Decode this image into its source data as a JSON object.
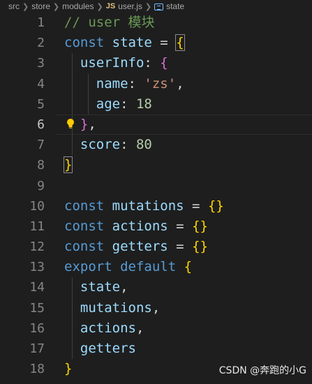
{
  "breadcrumb": {
    "items": [
      "src",
      "store",
      "modules"
    ],
    "file_badge": "JS",
    "file": "user.js",
    "symbol": "state",
    "symbol_icon": "symbol-variable-icon"
  },
  "editor": {
    "active_line": 6,
    "lines": [
      {
        "num": "1",
        "tokens": [
          {
            "c": "cmt",
            "t": "// user 模块"
          }
        ]
      },
      {
        "num": "2",
        "tokens": [
          {
            "c": "kw",
            "t": "const"
          },
          {
            "c": "op",
            "t": " "
          },
          {
            "c": "var",
            "t": "state"
          },
          {
            "c": "op",
            "t": " = "
          },
          {
            "c": "b1 b-hl",
            "t": "{"
          }
        ]
      },
      {
        "num": "3",
        "tokens": [
          {
            "c": "op",
            "t": "  "
          },
          {
            "c": "prop",
            "t": "userInfo"
          },
          {
            "c": "op",
            "t": ": "
          },
          {
            "c": "b2",
            "t": "{"
          }
        ]
      },
      {
        "num": "4",
        "tokens": [
          {
            "c": "op",
            "t": "    "
          },
          {
            "c": "prop",
            "t": "name"
          },
          {
            "c": "op",
            "t": ": "
          },
          {
            "c": "str",
            "t": "'zs'"
          },
          {
            "c": "op",
            "t": ","
          }
        ]
      },
      {
        "num": "5",
        "tokens": [
          {
            "c": "op",
            "t": "    "
          },
          {
            "c": "prop",
            "t": "age"
          },
          {
            "c": "op",
            "t": ": "
          },
          {
            "c": "numv",
            "t": "18"
          }
        ]
      },
      {
        "num": "6",
        "tokens": [
          {
            "c": "op",
            "t": "  "
          },
          {
            "c": "b2",
            "t": "}"
          },
          {
            "c": "op",
            "t": ","
          }
        ]
      },
      {
        "num": "7",
        "tokens": [
          {
            "c": "op",
            "t": "  "
          },
          {
            "c": "prop",
            "t": "score"
          },
          {
            "c": "op",
            "t": ": "
          },
          {
            "c": "numv",
            "t": "80"
          }
        ]
      },
      {
        "num": "8",
        "tokens": [
          {
            "c": "b1 b-hl",
            "t": "}"
          }
        ]
      },
      {
        "num": "9",
        "tokens": []
      },
      {
        "num": "10",
        "tokens": [
          {
            "c": "kw",
            "t": "const"
          },
          {
            "c": "op",
            "t": " "
          },
          {
            "c": "var",
            "t": "mutations"
          },
          {
            "c": "op",
            "t": " = "
          },
          {
            "c": "b1",
            "t": "{}"
          }
        ]
      },
      {
        "num": "11",
        "tokens": [
          {
            "c": "kw",
            "t": "const"
          },
          {
            "c": "op",
            "t": " "
          },
          {
            "c": "var",
            "t": "actions"
          },
          {
            "c": "op",
            "t": " = "
          },
          {
            "c": "b1",
            "t": "{}"
          }
        ]
      },
      {
        "num": "12",
        "tokens": [
          {
            "c": "kw",
            "t": "const"
          },
          {
            "c": "op",
            "t": " "
          },
          {
            "c": "var",
            "t": "getters"
          },
          {
            "c": "op",
            "t": " = "
          },
          {
            "c": "b1",
            "t": "{}"
          }
        ]
      },
      {
        "num": "13",
        "tokens": [
          {
            "c": "kw",
            "t": "export"
          },
          {
            "c": "op",
            "t": " "
          },
          {
            "c": "kw",
            "t": "default"
          },
          {
            "c": "op",
            "t": " "
          },
          {
            "c": "b1",
            "t": "{"
          }
        ]
      },
      {
        "num": "14",
        "tokens": [
          {
            "c": "op",
            "t": "  "
          },
          {
            "c": "prop",
            "t": "state"
          },
          {
            "c": "op",
            "t": ","
          }
        ]
      },
      {
        "num": "15",
        "tokens": [
          {
            "c": "op",
            "t": "  "
          },
          {
            "c": "prop",
            "t": "mutations"
          },
          {
            "c": "op",
            "t": ","
          }
        ]
      },
      {
        "num": "16",
        "tokens": [
          {
            "c": "op",
            "t": "  "
          },
          {
            "c": "prop",
            "t": "actions"
          },
          {
            "c": "op",
            "t": ","
          }
        ]
      },
      {
        "num": "17",
        "tokens": [
          {
            "c": "op",
            "t": "  "
          },
          {
            "c": "prop",
            "t": "getters"
          }
        ]
      },
      {
        "num": "18",
        "tokens": [
          {
            "c": "b1",
            "t": "}"
          }
        ]
      }
    ]
  },
  "lightbulb_icon": "lightbulb-icon",
  "watermark": "CSDN @奔跑的小G",
  "colors": {
    "background": "#1e1e1e",
    "keyword": "#569cd6",
    "variable": "#9cdcfe",
    "string": "#ce9178",
    "number": "#b5cea8",
    "comment": "#6a9955",
    "bracket_level1": "#ffd700",
    "bracket_level2": "#da70d6"
  }
}
